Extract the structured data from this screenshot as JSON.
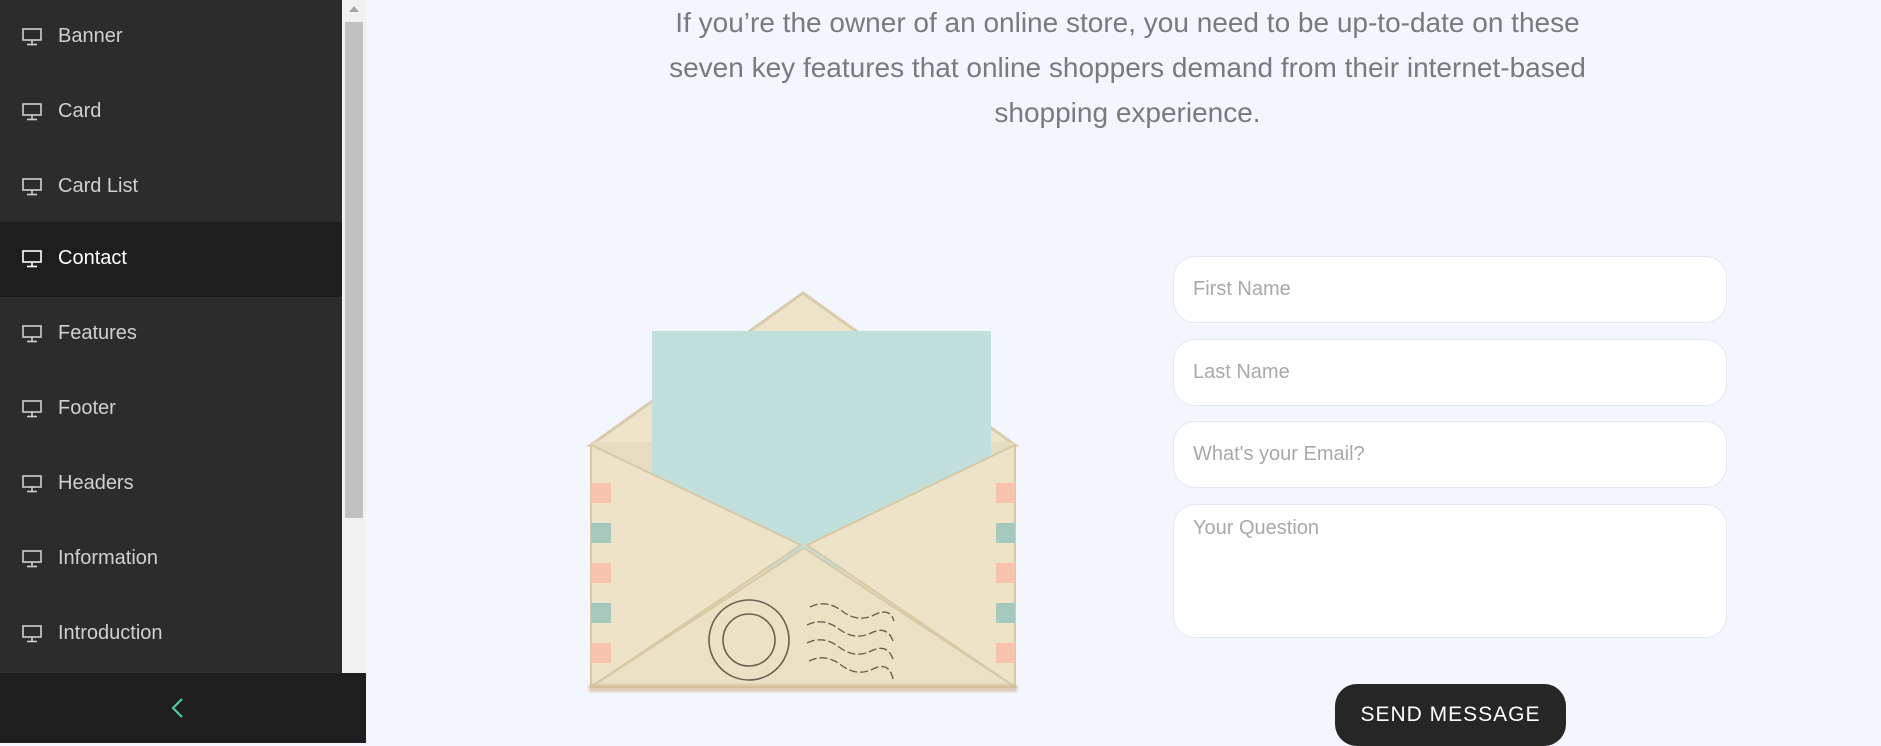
{
  "sidebar": {
    "items": [
      {
        "label": "Banner",
        "icon": "monitor-icon",
        "active": false
      },
      {
        "label": "Card",
        "icon": "monitor-icon",
        "active": false
      },
      {
        "label": "Card List",
        "icon": "monitor-icon",
        "active": false
      },
      {
        "label": "Contact",
        "icon": "monitor-icon",
        "active": true
      },
      {
        "label": "Features",
        "icon": "monitor-icon",
        "active": false
      },
      {
        "label": "Footer",
        "icon": "monitor-icon",
        "active": false
      },
      {
        "label": "Headers",
        "icon": "monitor-icon",
        "active": false
      },
      {
        "label": "Information",
        "icon": "monitor-icon",
        "active": false
      },
      {
        "label": "Introduction",
        "icon": "monitor-icon",
        "active": false
      }
    ],
    "collapse_icon": "chevron-left-icon",
    "accent_color": "#4cc9a0"
  },
  "intro": {
    "line1": "If you’re the owner of an online store, you need to be up-to-date on these",
    "line2": "seven key features that online shoppers demand from their internet-based",
    "line3": "shopping experience."
  },
  "form": {
    "first_name_placeholder": "First Name",
    "last_name_placeholder": "Last Name",
    "email_placeholder": "What's your Email?",
    "question_placeholder": "Your Question",
    "send_label": "SEND MESSAGE"
  },
  "illustration": "envelope-with-letter"
}
